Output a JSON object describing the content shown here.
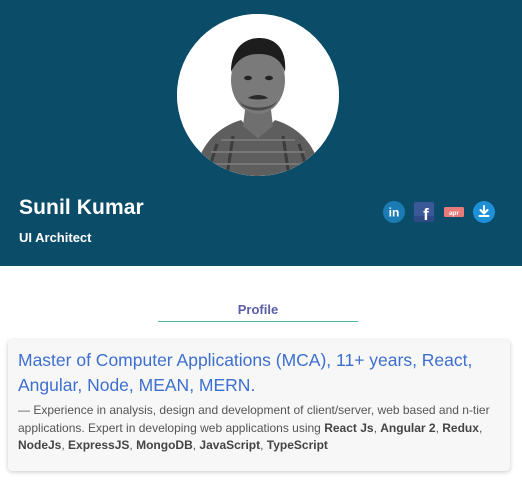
{
  "profile": {
    "name": "Sunil Kumar",
    "role": "UI Architect"
  },
  "social": [
    {
      "id": "linkedin",
      "icon": "linkedin-icon",
      "text": "in",
      "color": "#1a7bb5"
    },
    {
      "id": "facebook",
      "icon": "facebook-icon",
      "text": "f",
      "color": "#3b5998"
    },
    {
      "id": "blogger",
      "icon": "blog-icon",
      "text": "apr",
      "color": "#e87a7a"
    },
    {
      "id": "download",
      "icon": "download-icon",
      "text": "",
      "color": "#1e90d8"
    }
  ],
  "section": {
    "title": "Profile"
  },
  "summary": {
    "headline": "Master of Computer Applications (MCA), 11+ years, React, Angular, Node, MEAN, MERN.",
    "intro": "— Experience in analysis, design and development of client/server, web based and n-tier applications. Expert in developing web applications using ",
    "skills": [
      "React Js",
      "Angular 2",
      "Redux",
      "NodeJs",
      "ExpressJS",
      "MongoDB",
      "JavaScript",
      "TypeScript"
    ],
    "separator": ", "
  },
  "colors": {
    "header_bg": "#0b4d69",
    "accent_title": "#5b5ea6",
    "accent_line": "#4fb6ad",
    "headline": "#3d6fcf"
  }
}
